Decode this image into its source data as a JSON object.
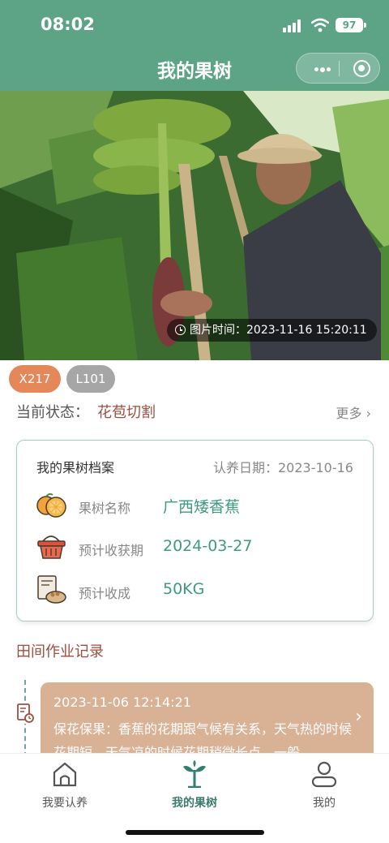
{
  "status_bar": {
    "time": "08:02",
    "battery": "97"
  },
  "header": {
    "title": "我的果树"
  },
  "photo": {
    "time_label": "图片时间：2023-11-16 15:20:11"
  },
  "tags": [
    "X217",
    "L101"
  ],
  "status": {
    "label": "当前状态：",
    "value": "花苞切割",
    "more": "更多"
  },
  "profile": {
    "title": "我的果树档案",
    "adopt_date": "认养日期：2023-10-16",
    "rows": [
      {
        "icon": "orange-fruit-icon",
        "label": "果树名称",
        "value": "广西矮香蕉"
      },
      {
        "icon": "basket-icon",
        "label": "预计收获期",
        "value": "2024-03-27"
      },
      {
        "icon": "harvest-jar-icon",
        "label": "预计收成",
        "value": "50KG"
      }
    ]
  },
  "records": {
    "title": "田间作业记录",
    "items": [
      {
        "time": "2023-11-06 12:14:21",
        "text": "保花保果：香蕉的花期跟气候有关系，天气热的时候花期短，天气凉的时候花期稍微长点，一般"
      }
    ]
  },
  "nav": {
    "items": [
      {
        "label": "我要认养",
        "icon": "home-icon",
        "active": false
      },
      {
        "label": "我的果树",
        "icon": "sprout-icon",
        "active": true
      },
      {
        "label": "我的",
        "icon": "user-icon",
        "active": false
      }
    ]
  },
  "colors": {
    "header": "#5da386",
    "accent_green": "#3e9a7f",
    "accent_red": "#9e4d3e",
    "record_bg": "#d9b195",
    "tag_orange": "#e4885a",
    "tag_gray": "#a6a6a6"
  }
}
